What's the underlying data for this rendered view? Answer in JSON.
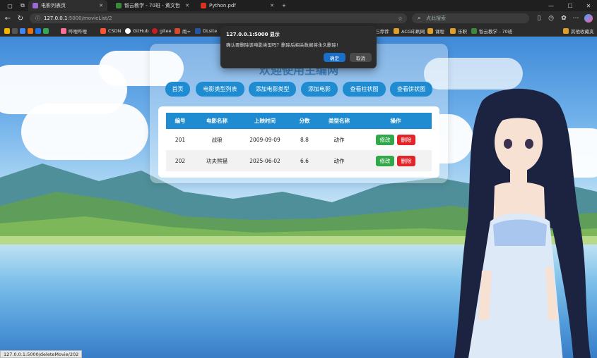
{
  "browser": {
    "tabs": [
      {
        "title": "电影列表页",
        "active": true
      },
      {
        "title": "智云教学 - 70班 - 黄文哲",
        "active": false
      },
      {
        "title": "Python.pdf",
        "active": false
      }
    ],
    "new_tab": "+",
    "url_host": "127.0.0.1",
    "url_path": ":5000/movieList/2",
    "search_placeholder": "点此搜索",
    "bookmarks": [
      {
        "label": "哔哩哔哩",
        "color": "#fb7299"
      },
      {
        "label": "CSDN",
        "color": "#fc5531"
      },
      {
        "label": "GitHub",
        "color": "#ffffff"
      },
      {
        "label": "gitee",
        "color": "#c71d23"
      },
      {
        "label": "雨+",
        "color": "#d64a2e"
      },
      {
        "label": "DLsite",
        "color": "#2456a4"
      }
    ],
    "bookmarks_right": [
      {
        "label": "石荐荐",
        "color": "#777777"
      },
      {
        "label": "ACG印刷网",
        "color": "#e0a028"
      },
      {
        "label": "课程",
        "color": "#e0a028"
      },
      {
        "label": "乐职",
        "color": "#e0a028"
      },
      {
        "label": "智云教学 - 70班",
        "color": "#3b8a3b"
      }
    ],
    "other_bookmarks": "其他收藏夹",
    "status_url": "127.0.0.1:5000/deleteMovie/202"
  },
  "page": {
    "title": "欢迎使用主编网",
    "nav": [
      {
        "label": "首页"
      },
      {
        "label": "电影类型列表"
      },
      {
        "label": "添加电影类型"
      },
      {
        "label": "添加电影"
      },
      {
        "label": "查看柱状图"
      },
      {
        "label": "查看饼状图"
      }
    ],
    "table": {
      "headers": [
        "编号",
        "电影名称",
        "上映时间",
        "分数",
        "类型名称",
        "操作"
      ],
      "rows": [
        {
          "id": "201",
          "name": "战狼",
          "date": "2009-09-09",
          "score": "8.8",
          "type": "动作"
        },
        {
          "id": "202",
          "name": "功夫熊猫",
          "date": "2025-06-02",
          "score": "6.6",
          "type": "动作"
        }
      ],
      "edit_label": "修改",
      "delete_label": "删除"
    }
  },
  "dialog": {
    "title": "127.0.0.1:5000 显示",
    "message": "确认要删除该电影类型吗？删除后相关数据将永久删除!",
    "ok_label": "确定",
    "cancel_label": "取消"
  },
  "colors": {
    "primary": "#1f8bd0",
    "edit": "#33a84a",
    "delete": "#e0262b",
    "dialog_ok": "#1a6fc9"
  }
}
